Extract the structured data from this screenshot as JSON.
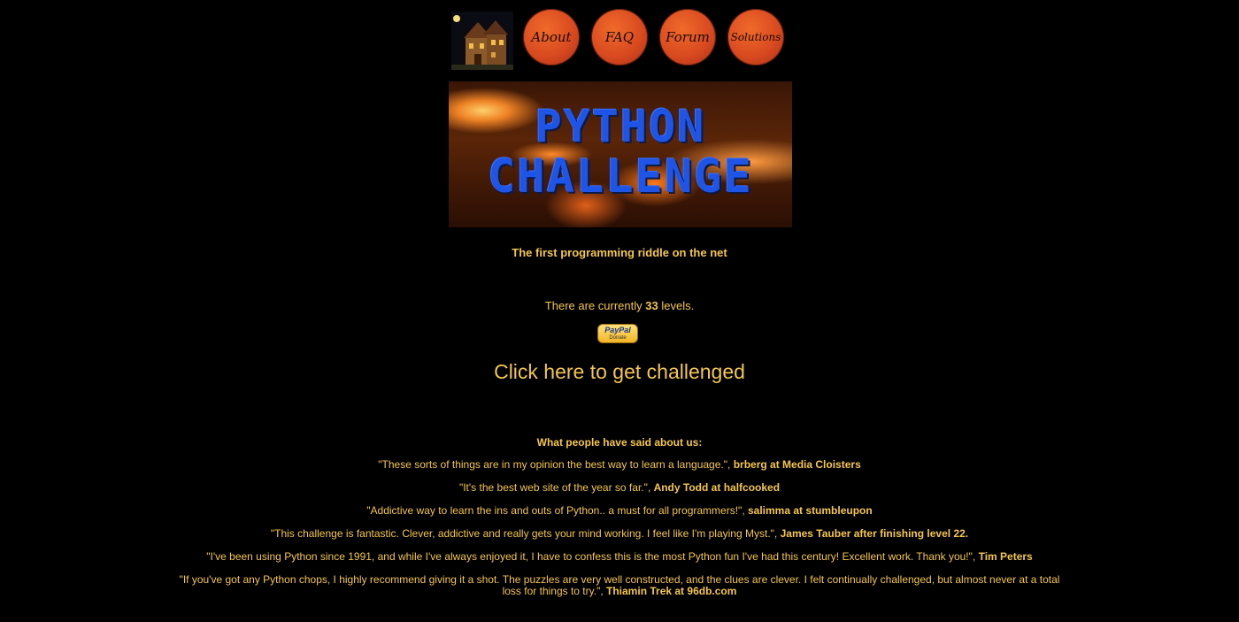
{
  "nav": {
    "items": [
      {
        "label": "About"
      },
      {
        "label": "FAQ"
      },
      {
        "label": "Forum"
      },
      {
        "label": "Solutions"
      }
    ]
  },
  "banner": {
    "line1": "PYTHON",
    "line2": "CHALLENGE"
  },
  "tagline": "The first programming riddle on the net",
  "levels": {
    "prefix": "There are currently",
    "count": "33",
    "suffix": "levels."
  },
  "paypal": {
    "brand": "PayPal",
    "action": "Donate"
  },
  "challenge_link": "Click here to get challenged",
  "testimonials_heading": "What people have said about us:",
  "quotes": [
    {
      "text": "\"These sorts of things are in my opinion the best way to learn a language.\",",
      "author": "brberg at",
      "link": "Media Cloisters"
    },
    {
      "text": "\"It's the best web site of the year so far.\",",
      "author": "Andy Todd at",
      "link": "halfcooked"
    },
    {
      "text": "\"Addictive way to learn the ins and outs of Python.. a must for all programmers!\",",
      "author": "salimma at",
      "link": "stumbleupon"
    },
    {
      "text": "\"This challenge is fantastic. Clever, addictive and really gets your mind working. I feel like I'm playing Myst.\",",
      "author": "James Tauber after finishing level 22.",
      "link": ""
    },
    {
      "text": "\"I've been using Python since 1991, and while I've always enjoyed it, I have to confess this is the most Python fun I've had this century! Excellent work. Thank you!\",",
      "author": "Tim Peters",
      "link": ""
    },
    {
      "text": "\"If you've got any Python chops, I highly recommend giving it a shot. The puzzles are very well constructed, and the clues are clever. I felt continually challenged, but almost never at a total loss for things to try.\",",
      "author": "Thiamin Trek at",
      "link": "96db.com"
    }
  ]
}
